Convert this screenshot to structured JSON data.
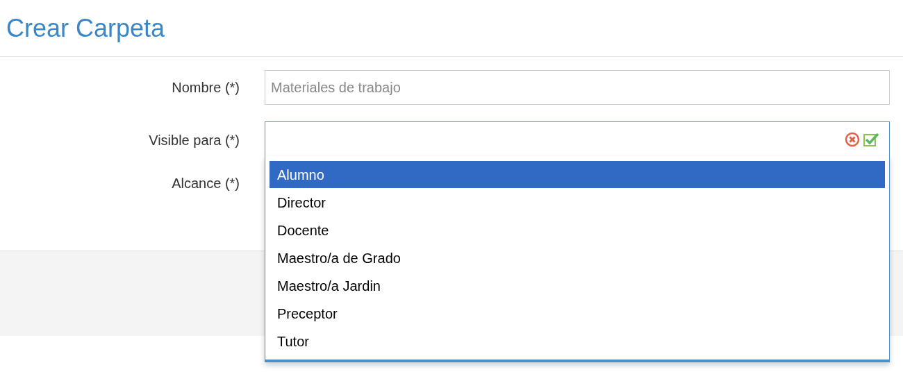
{
  "title": "Crear Carpeta",
  "form": {
    "nombre": {
      "label": "Nombre (*)",
      "placeholder": "Materiales de trabajo"
    },
    "visible_para": {
      "label": "Visible para (*)",
      "expanded": true,
      "options": [
        {
          "label": "Alumno",
          "selected": true
        },
        {
          "label": "Director",
          "selected": false
        },
        {
          "label": "Docente",
          "selected": false
        },
        {
          "label": "Maestro/a de Grado",
          "selected": false
        },
        {
          "label": "Maestro/a Jardin",
          "selected": false
        },
        {
          "label": "Preceptor",
          "selected": false
        },
        {
          "label": "Tutor",
          "selected": false
        }
      ]
    },
    "alcance": {
      "label": "Alcance (*)"
    }
  }
}
